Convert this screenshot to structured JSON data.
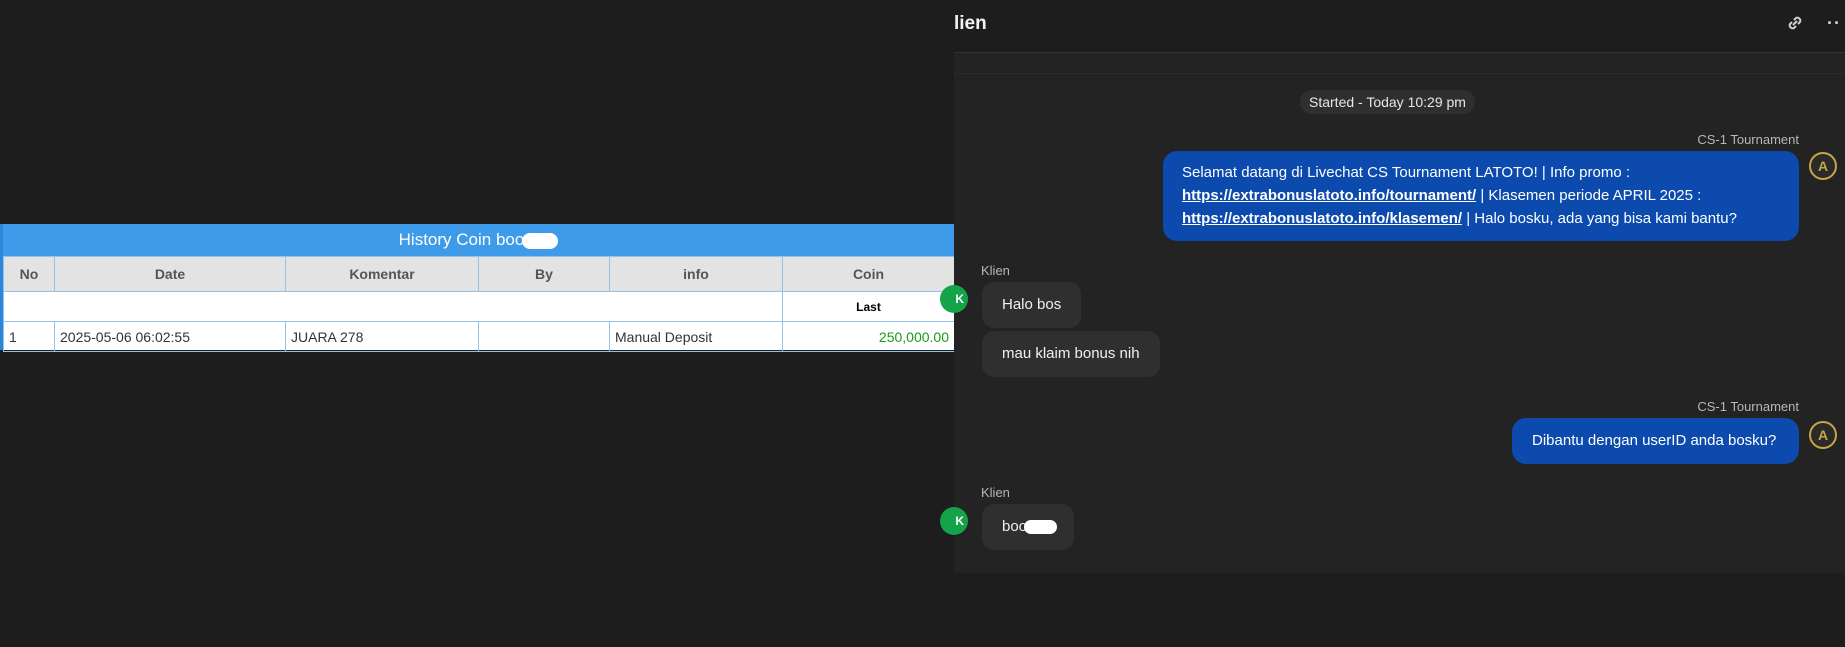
{
  "history_table": {
    "title": "History Coin boo",
    "columns": [
      "No",
      "Date",
      "Komentar",
      "By",
      "info",
      "Coin"
    ],
    "last_label": "Last",
    "rows": [
      {
        "no": "1",
        "date": "2025-05-06 06:02:55",
        "komentar": "JUARA 278",
        "by": "",
        "info": "Manual Deposit",
        "coin": "250,000.00"
      }
    ]
  },
  "chat": {
    "title": "lien",
    "link_icon": "link-icon",
    "more_icon": "more-icon",
    "started": "Started - Today 10:29 pm",
    "messages": {
      "m1_sender": "CS-1 Tournament",
      "m1_line1": "Selamat datang di Livechat CS Tournament LATOTO! | Info promo :",
      "m1_link1": "https://extrabonuslatoto.info/tournament/",
      "m1_line2": " | Klasemen periode APRIL 2025 :",
      "m1_link2": "https://extrabonuslatoto.info/klasemen/",
      "m1_line3": " | Halo bosku, ada yang bisa kami bantu?",
      "m2_sender": "Klien",
      "m2_text": "Halo bos",
      "m3_text": "mau klaim bonus nih",
      "m4_sender": "CS-1 Tournament",
      "m4_text": "Dibantu dengan userID anda bosku?",
      "m5_sender": "Klien",
      "m5_text": "boo"
    },
    "agent_avatar_letter": "A",
    "client_avatar_letter": "K"
  },
  "colors": {
    "table_header": "#3d9be9",
    "coin_green": "#1a9a1a",
    "agent_bubble": "#0c4aad",
    "client_avatar": "#15a34a"
  }
}
